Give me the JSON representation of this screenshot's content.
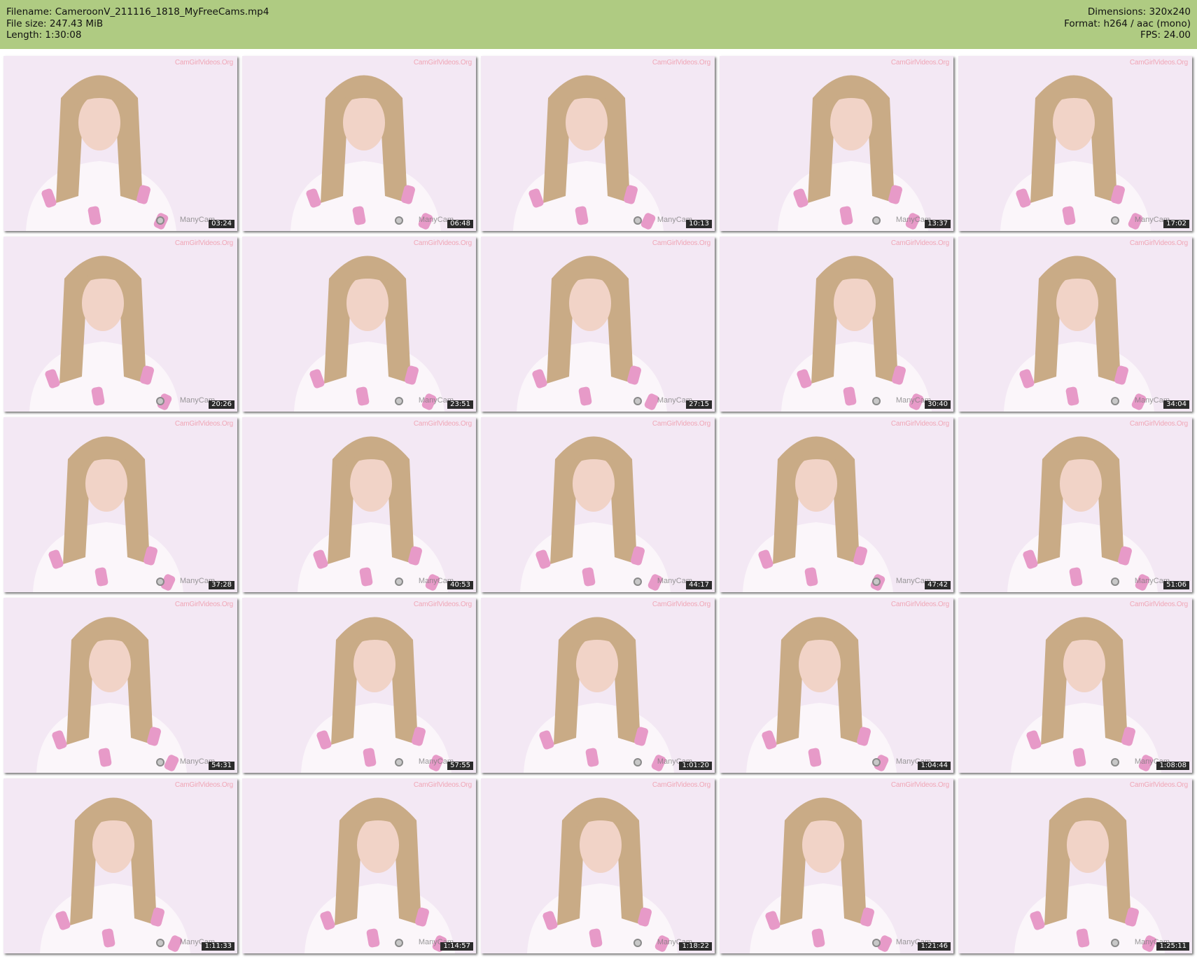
{
  "meta": {
    "filename_line": "Filename: CameroonV_211116_1818_MyFreeCams.mp4",
    "filesize_line": "File size: 247.43 MiB",
    "length_line": "Length: 1:30:08",
    "dimensions_line": "Dimensions: 320x240",
    "format_line": "Format: h264 / aac (mono)",
    "fps_line": "FPS: 24.00"
  },
  "watermarks": {
    "top": "CamGirlVideos.Org",
    "bottom": "ManyCam"
  },
  "colors": {
    "header_bg": "#afcb82",
    "thumb_bg": "#f3e8f4",
    "shirt": "#fbf6fa",
    "popsicle": "#e79ac8",
    "hair": "#c9ab86",
    "skin": "#f1d3c7"
  },
  "thumbnails": [
    {
      "time": "03:24"
    },
    {
      "time": "06:48"
    },
    {
      "time": "10:13"
    },
    {
      "time": "13:37"
    },
    {
      "time": "17:02"
    },
    {
      "time": "20:26"
    },
    {
      "time": "23:51"
    },
    {
      "time": "27:15"
    },
    {
      "time": "30:40"
    },
    {
      "time": "34:04"
    },
    {
      "time": "37:28"
    },
    {
      "time": "40:53"
    },
    {
      "time": "44:17"
    },
    {
      "time": "47:42"
    },
    {
      "time": "51:06"
    },
    {
      "time": "54:31"
    },
    {
      "time": "57:55"
    },
    {
      "time": "1:01:20"
    },
    {
      "time": "1:04:44"
    },
    {
      "time": "1:08:08"
    },
    {
      "time": "1:11:33"
    },
    {
      "time": "1:14:57"
    },
    {
      "time": "1:18:22"
    },
    {
      "time": "1:21:46"
    },
    {
      "time": "1:25:11"
    }
  ]
}
